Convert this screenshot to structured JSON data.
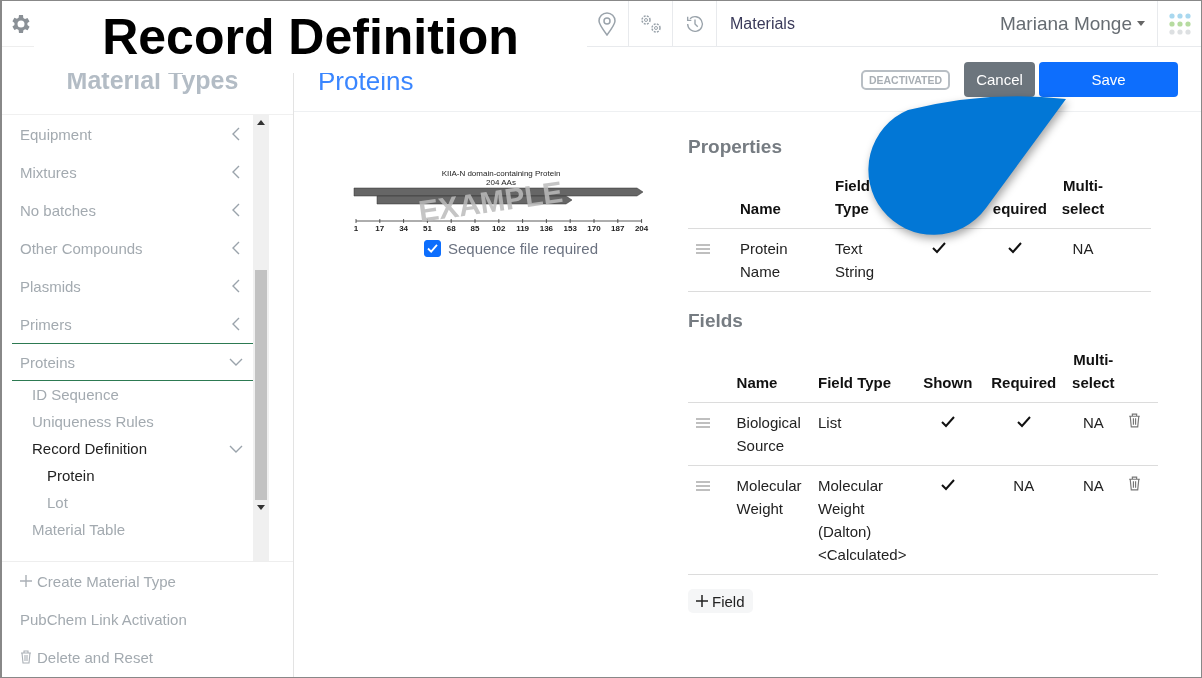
{
  "annotation": {
    "title": "Record Definition"
  },
  "topbar": {
    "module": "Materials",
    "user": "Mariana Monge"
  },
  "sidebar": {
    "heading": "Material Types",
    "items": [
      {
        "label": "Equipment",
        "expanded": false,
        "selected": false
      },
      {
        "label": "Mixtures",
        "expanded": false,
        "selected": false
      },
      {
        "label": "No batches",
        "expanded": false,
        "selected": false
      },
      {
        "label": "Other Compounds",
        "expanded": false,
        "selected": false
      },
      {
        "label": "Plasmids",
        "expanded": false,
        "selected": false
      },
      {
        "label": "Primers",
        "expanded": false,
        "selected": false
      },
      {
        "label": "Proteins",
        "expanded": true,
        "selected": false,
        "children": [
          {
            "label": "ID Sequence",
            "selected": false
          },
          {
            "label": "Uniqueness Rules",
            "selected": false
          },
          {
            "label": "Record Definition",
            "selected": true,
            "expanded": true,
            "children": [
              {
                "label": "Protein",
                "selected": true
              },
              {
                "label": "Lot",
                "selected": false
              }
            ]
          },
          {
            "label": "Material Table",
            "selected": false
          }
        ]
      }
    ],
    "footer": [
      {
        "kind": "add",
        "label": "Create Material Type"
      },
      {
        "kind": "plain",
        "label": "PubChem Link Activation"
      },
      {
        "kind": "delete",
        "label": "Delete and Reset"
      }
    ]
  },
  "page": {
    "heading": "Proteins",
    "status_badge": "DEACTIVATED",
    "buttons": [
      {
        "label": "Cancel",
        "kind": "secondary"
      },
      {
        "label": "Save",
        "kind": "primary"
      }
    ]
  },
  "sequence_preview": {
    "title": "KIIA-N domain-containing Protein",
    "subtitle": "204 AAs",
    "watermark": "EXAMPLE",
    "ticks": [
      "1",
      "17",
      "34",
      "51",
      "68",
      "85",
      "102",
      "119",
      "136",
      "153",
      "170",
      "187",
      "204"
    ],
    "checkbox": {
      "label": "Sequence file required",
      "checked": true
    }
  },
  "properties": {
    "title": "Properties",
    "columns": [
      {
        "label": "Name"
      },
      {
        "label": "Field Type"
      },
      {},
      {
        "label": "equired"
      },
      {
        "label": "Multi-select"
      }
    ],
    "rows": [
      {
        "name": "Protein Name",
        "field_type": "Text String",
        "shown": {
          "kind": "check",
          "checked": true
        },
        "required": {
          "kind": "check",
          "checked": true
        },
        "multiselect": "NA",
        "deletable": false
      }
    ]
  },
  "fields": {
    "title": "Fields",
    "columns": [
      {
        "label": "Name"
      },
      {
        "label": "Field Type"
      },
      {
        "label": "Shown"
      },
      {
        "label": "Required"
      },
      {
        "label": "Multi-select"
      }
    ],
    "rows": [
      {
        "name": "Biological Source",
        "field_type": "List",
        "shown": {
          "kind": "check",
          "checked": true
        },
        "required": {
          "kind": "check",
          "checked": true
        },
        "multiselect": "NA",
        "deletable": true
      },
      {
        "name": "Molecular Weight",
        "field_type": "Molecular Weight (Dalton) <Calculated>",
        "shown": {
          "kind": "check",
          "checked": true
        },
        "required": {
          "kind": "text",
          "text": "NA"
        },
        "multiselect": "NA",
        "deletable": true
      }
    ],
    "add_button": "Field"
  }
}
